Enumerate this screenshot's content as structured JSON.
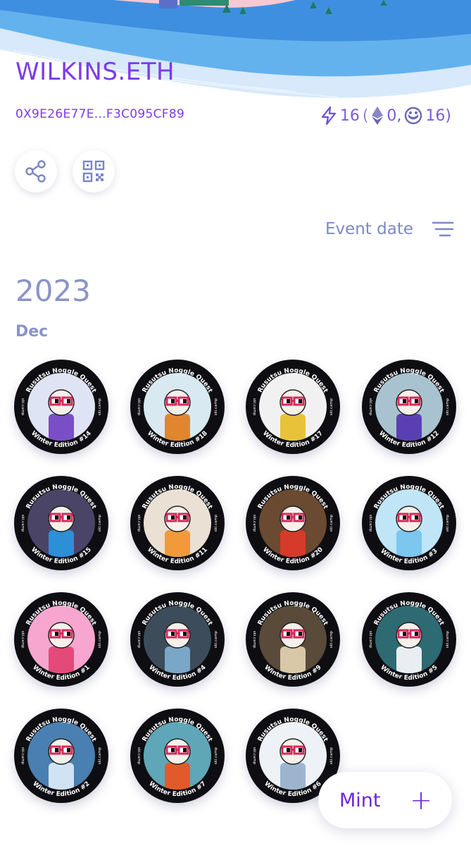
{
  "profile": {
    "ens_name": "WILKINS.ETH",
    "address": "0X9E26E77E...F3C095CF89",
    "stats": {
      "total": "16",
      "open": " (",
      "eth": "0,",
      "gnosis": "16)"
    }
  },
  "actions": {
    "share_icon": "share-icon",
    "qr_icon": "qr-code-icon"
  },
  "sort": {
    "label": "Event date",
    "icon": "filter-lines-icon"
  },
  "sections": [
    {
      "year": "2023",
      "month": "Dec"
    }
  ],
  "badge_ring": {
    "top_text": "Rusutsu Noggle Quest",
    "left_text": "ski.camp",
    "right_text": "ski.camp"
  },
  "badges": [
    {
      "edition": "Winter Edition #14",
      "bg": "#dfe4f4",
      "accent": "#7a4ec7"
    },
    {
      "edition": "Winter Edition #18",
      "bg": "#d9e9f2",
      "accent": "#e0862e"
    },
    {
      "edition": "Winter Edition #17",
      "bg": "#f1f1f1",
      "accent": "#e8c33a"
    },
    {
      "edition": "Winter Edition #12",
      "bg": "#a8c3cf",
      "accent": "#5a3fb4"
    },
    {
      "edition": "Winter Edition #15",
      "bg": "#4a4466",
      "accent": "#2d8fd6"
    },
    {
      "edition": "Winter Edition #11",
      "bg": "#eae0d4",
      "accent": "#f09a3a"
    },
    {
      "edition": "Winter Edition #20",
      "bg": "#6a4a30",
      "accent": "#d63a2a"
    },
    {
      "edition": "Winter Edition #3",
      "bg": "#bfe5f7",
      "accent": "#7cc6ef"
    },
    {
      "edition": "Winter Edition #1",
      "bg": "#f6a6cf",
      "accent": "#e34a7a"
    },
    {
      "edition": "Winter Edition #4",
      "bg": "#3c4c5a",
      "accent": "#7aa7c7"
    },
    {
      "edition": "Winter Edition #9",
      "bg": "#5a4a3a",
      "accent": "#d8c8a8"
    },
    {
      "edition": "Winter Edition #5",
      "bg": "#2e6a72",
      "accent": "#e8eef2"
    },
    {
      "edition": "Winter Edition #2",
      "bg": "#4a7fb2",
      "accent": "#cfe3f3"
    },
    {
      "edition": "Winter Edition #7",
      "bg": "#5fa7b8",
      "accent": "#e25a2a"
    },
    {
      "edition": "Winter Edition #6",
      "bg": "#eef1f6",
      "accent": "#9db4cf"
    }
  ],
  "mint_button": {
    "label": "Mint",
    "plus": "+"
  },
  "colors": {
    "accent": "#7c3aed",
    "muted_label": "#8a94c8"
  }
}
